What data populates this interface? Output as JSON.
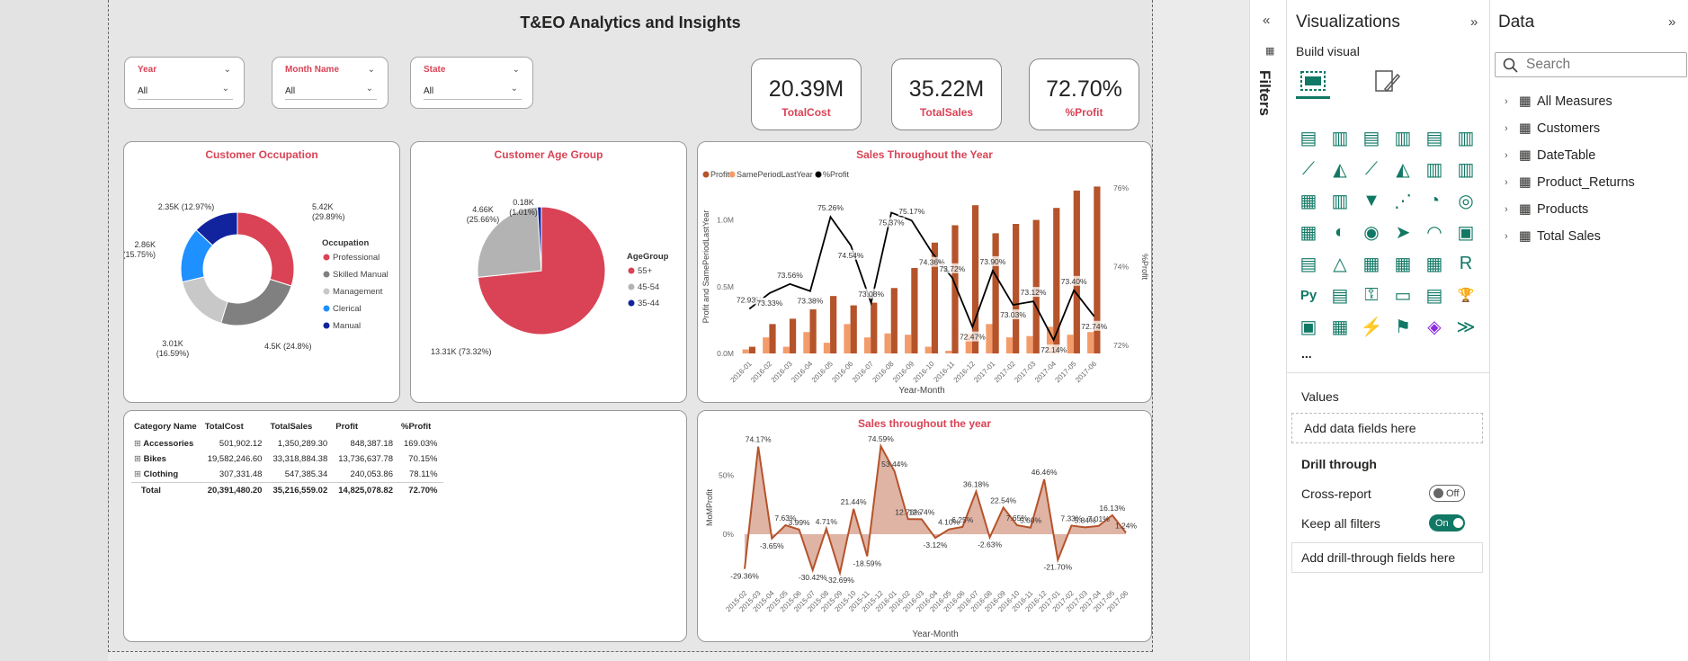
{
  "page_title": "T&EO Analytics and Insights",
  "slicers": [
    {
      "label": "Year",
      "value": "All"
    },
    {
      "label": "Month Name",
      "value": "All"
    },
    {
      "label": "State",
      "value": "All"
    }
  ],
  "kpis": [
    {
      "value": "20.39M",
      "label": "TotalCost"
    },
    {
      "value": "35.22M",
      "label": "TotalSales"
    },
    {
      "value": "72.70%",
      "label": "%Profit"
    }
  ],
  "occupation": {
    "title": "Customer Occupation",
    "legend_title": "Occupation",
    "items": [
      "Professional",
      "Skilled Manual",
      "Management",
      "Clerical",
      "Manual"
    ],
    "colors": [
      "#d94355",
      "#808080",
      "#c8c8c8",
      "#1e90ff",
      "#12239e"
    ],
    "labels": [
      "5.42K\n(29.89%)",
      "4.5K (24.8%)",
      "3.01K\n(16.59%)",
      "2.86K\n(15.75%)",
      "2.35K (12.97%)"
    ]
  },
  "age": {
    "title": "Customer Age Group",
    "legend_title": "AgeGroup",
    "items": [
      "55+",
      "45-54",
      "35-44"
    ],
    "colors": [
      "#d94355",
      "#b3b3b3",
      "#12239e"
    ],
    "labels": [
      "13.31K (73.32%)",
      "4.66K\n(25.66%)",
      "0.18K\n(1.01%)"
    ]
  },
  "sales_year": {
    "title": "Sales Throughout the Year",
    "legend": [
      "Profit",
      "SamePeriodLastYear",
      "%Profit"
    ],
    "colors": [
      "#b5532b",
      "#f39c6b",
      "#000000"
    ],
    "xlabel": "Year-Month",
    "ylabel": "Profit and SamePeriodLastYear",
    "y2label": "%Profit",
    "yticks": [
      "0.0M",
      "0.5M",
      "1.0M"
    ],
    "y2ticks": [
      "72%",
      "74%",
      "76%"
    ]
  },
  "mom": {
    "title": "Sales throughout the year",
    "xlabel": "Year-Month",
    "ylabel": "MoMProfit",
    "yticks": [
      "0%",
      "50%"
    ]
  },
  "table": {
    "headers": [
      "Category Name",
      "TotalCost",
      "TotalSales",
      "Profit",
      "%Profit"
    ],
    "rows": [
      [
        "Accessories",
        "501,902.12",
        "1,350,289.30",
        "848,387.18",
        "169.03%"
      ],
      [
        "Bikes",
        "19,582,246.60",
        "33,318,884.38",
        "13,736,637.78",
        "70.15%"
      ],
      [
        "Clothing",
        "307,331.48",
        "547,385.34",
        "240,053.86",
        "78.11%"
      ]
    ],
    "total": [
      "Total",
      "20,391,480.20",
      "35,216,559.02",
      "14,825,078.82",
      "72.70%"
    ]
  },
  "chart_data": [
    {
      "type": "pie",
      "title": "Customer Occupation",
      "categories": [
        "Professional",
        "Skilled Manual",
        "Management",
        "Clerical",
        "Manual"
      ],
      "values": [
        5.42,
        4.5,
        3.01,
        2.86,
        2.35
      ],
      "percent": [
        29.89,
        24.8,
        16.59,
        15.75,
        12.97
      ],
      "unit": "K"
    },
    {
      "type": "pie",
      "title": "Customer Age Group",
      "categories": [
        "55+",
        "45-54",
        "35-44"
      ],
      "values": [
        13.31,
        4.66,
        0.18
      ],
      "percent": [
        73.32,
        25.66,
        1.01
      ],
      "unit": "K"
    },
    {
      "type": "bar",
      "title": "Sales Throughout the Year",
      "categories": [
        "2016-01",
        "2016-02",
        "2016-03",
        "2016-04",
        "2016-05",
        "2016-06",
        "2016-07",
        "2016-08",
        "2016-09",
        "2016-10",
        "2016-11",
        "2016-12",
        "2017-01",
        "2017-02",
        "2017-03",
        "2017-04",
        "2017-05",
        "2017-06"
      ],
      "series": [
        {
          "name": "Profit",
          "values": [
            0.05,
            0.22,
            0.26,
            0.33,
            0.43,
            0.36,
            0.38,
            0.49,
            0.64,
            0.83,
            0.96,
            1.11,
            0.9,
            0.97,
            1.0,
            1.09,
            1.22,
            1.25
          ]
        },
        {
          "name": "SamePeriodLastYear",
          "values": [
            0.03,
            0.12,
            0.05,
            0.16,
            0.08,
            0.22,
            0.12,
            0.15,
            0.14,
            0.05,
            0.02,
            0.15,
            0.22,
            0.12,
            0.13,
            0.2,
            0.14,
            0.16
          ]
        },
        {
          "name": "%Profit",
          "values": [
            72.93,
            73.33,
            73.56,
            73.38,
            75.26,
            74.54,
            73.08,
            75.37,
            75.17,
            74.36,
            73.72,
            72.47,
            73.9,
            73.03,
            73.12,
            72.14,
            73.4,
            72.74
          ]
        }
      ],
      "ylim": [
        0,
        1.3
      ],
      "y2lim": [
        71.8,
        76.2
      ]
    },
    {
      "type": "area",
      "title": "Sales throughout the year",
      "x": [
        "2015-02",
        "2015-03",
        "2015-04",
        "2015-05",
        "2015-06",
        "2015-07",
        "2015-08",
        "2015-09",
        "2015-10",
        "2015-11",
        "2015-12",
        "2016-01",
        "2016-02",
        "2016-03",
        "2016-04",
        "2016-05",
        "2016-06",
        "2016-07",
        "2016-08",
        "2016-09",
        "2016-10",
        "2016-11",
        "2016-12",
        "2017-01",
        "2017-02",
        "2017-03",
        "2017-04",
        "2017-05",
        "2017-06"
      ],
      "values": [
        -29.36,
        74.17,
        -3.65,
        7.63,
        3.99,
        -30.42,
        4.71,
        -32.69,
        21.44,
        -18.59,
        74.59,
        53.44,
        12.76,
        12.74,
        -3.12,
        4.1,
        6.25,
        36.18,
        -2.63,
        22.54,
        7.65,
        5.6,
        46.46,
        -21.7,
        7.33,
        5.84,
        7.01,
        16.13,
        1.24
      ],
      "ylim": [
        -35,
        80
      ]
    }
  ],
  "viz_pane": {
    "title": "Visualizations",
    "build_visual": "Build visual",
    "values_label": "Values",
    "add_data": "Add data fields here",
    "drill_through": "Drill through",
    "cross_report": "Cross-report",
    "cross_state": "Off",
    "keep_filters": "Keep all filters",
    "keep_state": "On",
    "add_drill": "Add drill-through fields here",
    "more": "..."
  },
  "filters_pane": {
    "label": "Filters"
  },
  "data_pane": {
    "title": "Data",
    "search_placeholder": "Search",
    "tables": [
      "All Measures",
      "Customers",
      "DateTable",
      "Product_Returns",
      "Products",
      "Total Sales"
    ]
  }
}
